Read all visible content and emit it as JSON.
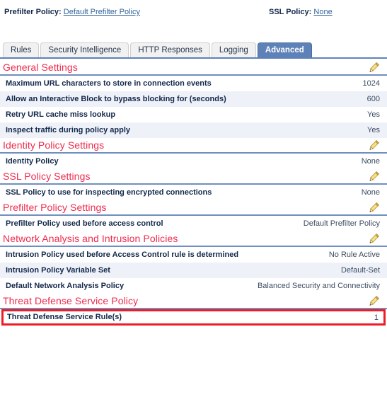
{
  "header": {
    "prefilter_label": "Prefilter Policy:",
    "prefilter_link": "Default Prefilter Policy",
    "ssl_label": "SSL Policy:",
    "ssl_link": "None"
  },
  "tabs": [
    {
      "label": "Rules",
      "active": false
    },
    {
      "label": "Security Intelligence",
      "active": false
    },
    {
      "label": "HTTP Responses",
      "active": false
    },
    {
      "label": "Logging",
      "active": false
    },
    {
      "label": "Advanced",
      "active": true
    }
  ],
  "sections": [
    {
      "title": "General Settings",
      "edit_icon": "pencil-icon",
      "rows": [
        {
          "label": "Maximum URL characters to store in connection events",
          "value": "1024"
        },
        {
          "label": "Allow an Interactive Block to bypass blocking for (seconds)",
          "value": "600"
        },
        {
          "label": "Retry URL cache miss lookup",
          "value": "Yes"
        },
        {
          "label": "Inspect traffic during policy apply",
          "value": "Yes"
        }
      ]
    },
    {
      "title": "Identity Policy Settings",
      "edit_icon": "pencil-icon",
      "rows": [
        {
          "label": "Identity Policy",
          "value": "None"
        }
      ]
    },
    {
      "title": "SSL Policy Settings",
      "edit_icon": "pencil-icon",
      "rows": [
        {
          "label": "SSL Policy to use for inspecting encrypted connections",
          "value": "None"
        }
      ]
    },
    {
      "title": "Prefilter Policy Settings",
      "edit_icon": "pencil-icon",
      "rows": [
        {
          "label": "Prefilter Policy used before access control",
          "value": "Default Prefilter Policy"
        }
      ]
    },
    {
      "title": "Network Analysis and Intrusion Policies",
      "edit_icon": "pencil-icon",
      "rows": [
        {
          "label": "Intrusion Policy used before Access Control rule is determined",
          "value": "No Rule Active"
        },
        {
          "label": "Intrusion Policy Variable Set",
          "value": "Default-Set"
        },
        {
          "label": "Default Network Analysis Policy",
          "value": "Balanced Security and Connectivity"
        }
      ]
    },
    {
      "title": "Threat Defense Service Policy",
      "edit_icon": "pencil-icon",
      "rows": [
        {
          "label": "Threat Defense Service Rule(s)",
          "value": "1",
          "highlight": true
        }
      ]
    }
  ],
  "colors": {
    "section_title": "#ef2b4e",
    "section_rule": "#6f8fc0",
    "active_tab": "#5e82b8",
    "link": "#32629c",
    "label": "#13284b",
    "row_alt": "#eef1f8",
    "highlight_border": "#ee1c25"
  }
}
